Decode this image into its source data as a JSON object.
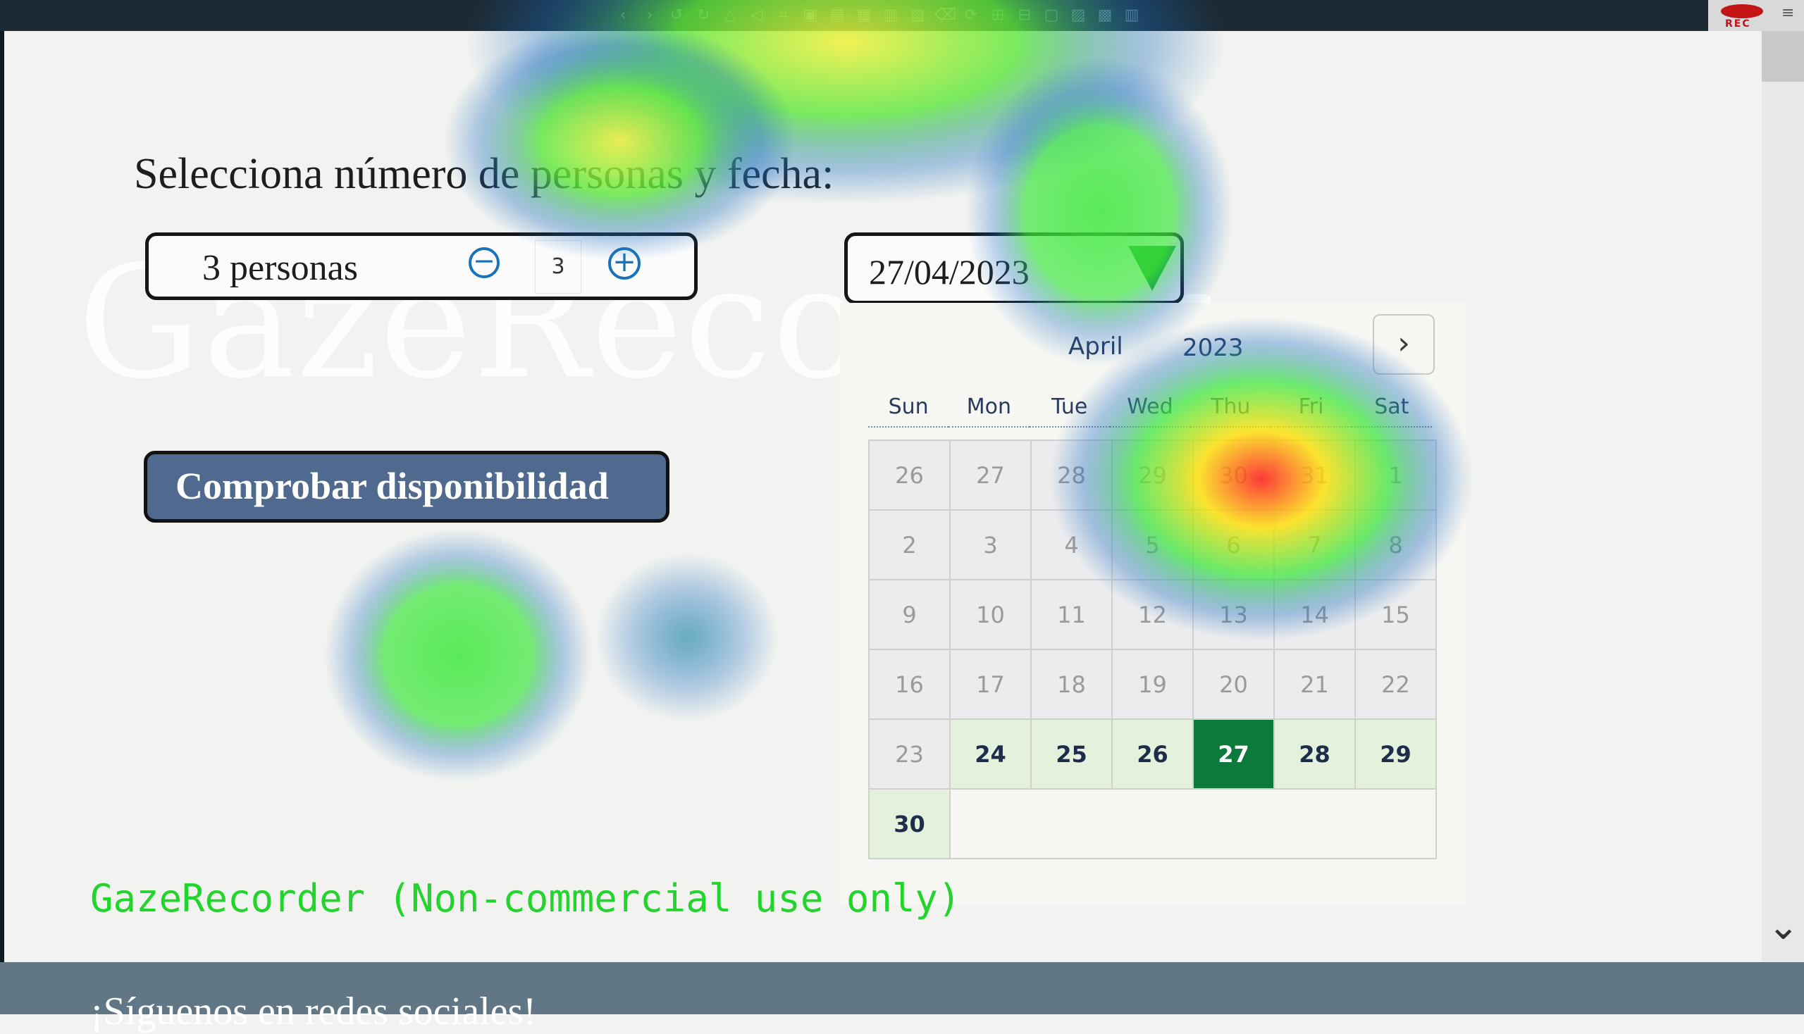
{
  "toolbar": {
    "icons": [
      "chevron-left-icon",
      "chevron-right-icon",
      "undo-icon",
      "redo-icon",
      "triangle-icon",
      "triangle-left-icon",
      "crop-icon",
      "frame-icon",
      "lock-icon",
      "highlight-icon",
      "copy-icon",
      "delete-icon",
      "eraser-icon",
      "rotate-icon",
      "grid-icon",
      "grid-active-icon",
      "chat-icon",
      "image-icon",
      "calendar-icon",
      "trash-icon"
    ],
    "recording_label": "REC"
  },
  "watermark": "GazeRecorder",
  "heading": "Selecciona número de personas y fecha:",
  "persons": {
    "label": "3 personas",
    "minus": "−",
    "quantity": "3",
    "plus": "+"
  },
  "date": {
    "value": "27/04/2023"
  },
  "check_button": "Comprobar disponibilidad",
  "calendar": {
    "month": "April",
    "year": "2023",
    "next": "›",
    "weekdays": [
      "Sun",
      "Mon",
      "Tue",
      "Wed",
      "Thu",
      "Fri",
      "Sat"
    ],
    "days": [
      {
        "d": "26",
        "s": "out"
      },
      {
        "d": "27",
        "s": "out"
      },
      {
        "d": "28",
        "s": "out"
      },
      {
        "d": "29",
        "s": "out"
      },
      {
        "d": "30",
        "s": "out"
      },
      {
        "d": "31",
        "s": "out"
      },
      {
        "d": "1",
        "s": "out"
      },
      {
        "d": "2",
        "s": "out"
      },
      {
        "d": "3",
        "s": "out"
      },
      {
        "d": "4",
        "s": "out"
      },
      {
        "d": "5",
        "s": "out"
      },
      {
        "d": "6",
        "s": "out"
      },
      {
        "d": "7",
        "s": "out"
      },
      {
        "d": "8",
        "s": "out"
      },
      {
        "d": "9",
        "s": "out"
      },
      {
        "d": "10",
        "s": "out"
      },
      {
        "d": "11",
        "s": "out"
      },
      {
        "d": "12",
        "s": "out"
      },
      {
        "d": "13",
        "s": "out"
      },
      {
        "d": "14",
        "s": "out"
      },
      {
        "d": "15",
        "s": "out"
      },
      {
        "d": "16",
        "s": "out"
      },
      {
        "d": "17",
        "s": "out"
      },
      {
        "d": "18",
        "s": "out"
      },
      {
        "d": "19",
        "s": "out"
      },
      {
        "d": "20",
        "s": "out"
      },
      {
        "d": "21",
        "s": "out"
      },
      {
        "d": "22",
        "s": "out"
      },
      {
        "d": "23",
        "s": "out"
      },
      {
        "d": "24",
        "s": "avail"
      },
      {
        "d": "25",
        "s": "avail"
      },
      {
        "d": "26",
        "s": "avail"
      },
      {
        "d": "27",
        "s": "sel"
      },
      {
        "d": "28",
        "s": "avail"
      },
      {
        "d": "29",
        "s": "avail"
      },
      {
        "d": "30",
        "s": "avail"
      }
    ]
  },
  "gaze_label": "GazeRecorder (Non-commercial use only)",
  "footer_text": "¡Síguenos en redes sociales!",
  "colors": {
    "button_bg": "#4f6a8e",
    "selected_day": "#0b7a3a",
    "available_day": "#e4f1dd",
    "gaze_label": "#22d42b",
    "footer_bg": "#627786"
  }
}
